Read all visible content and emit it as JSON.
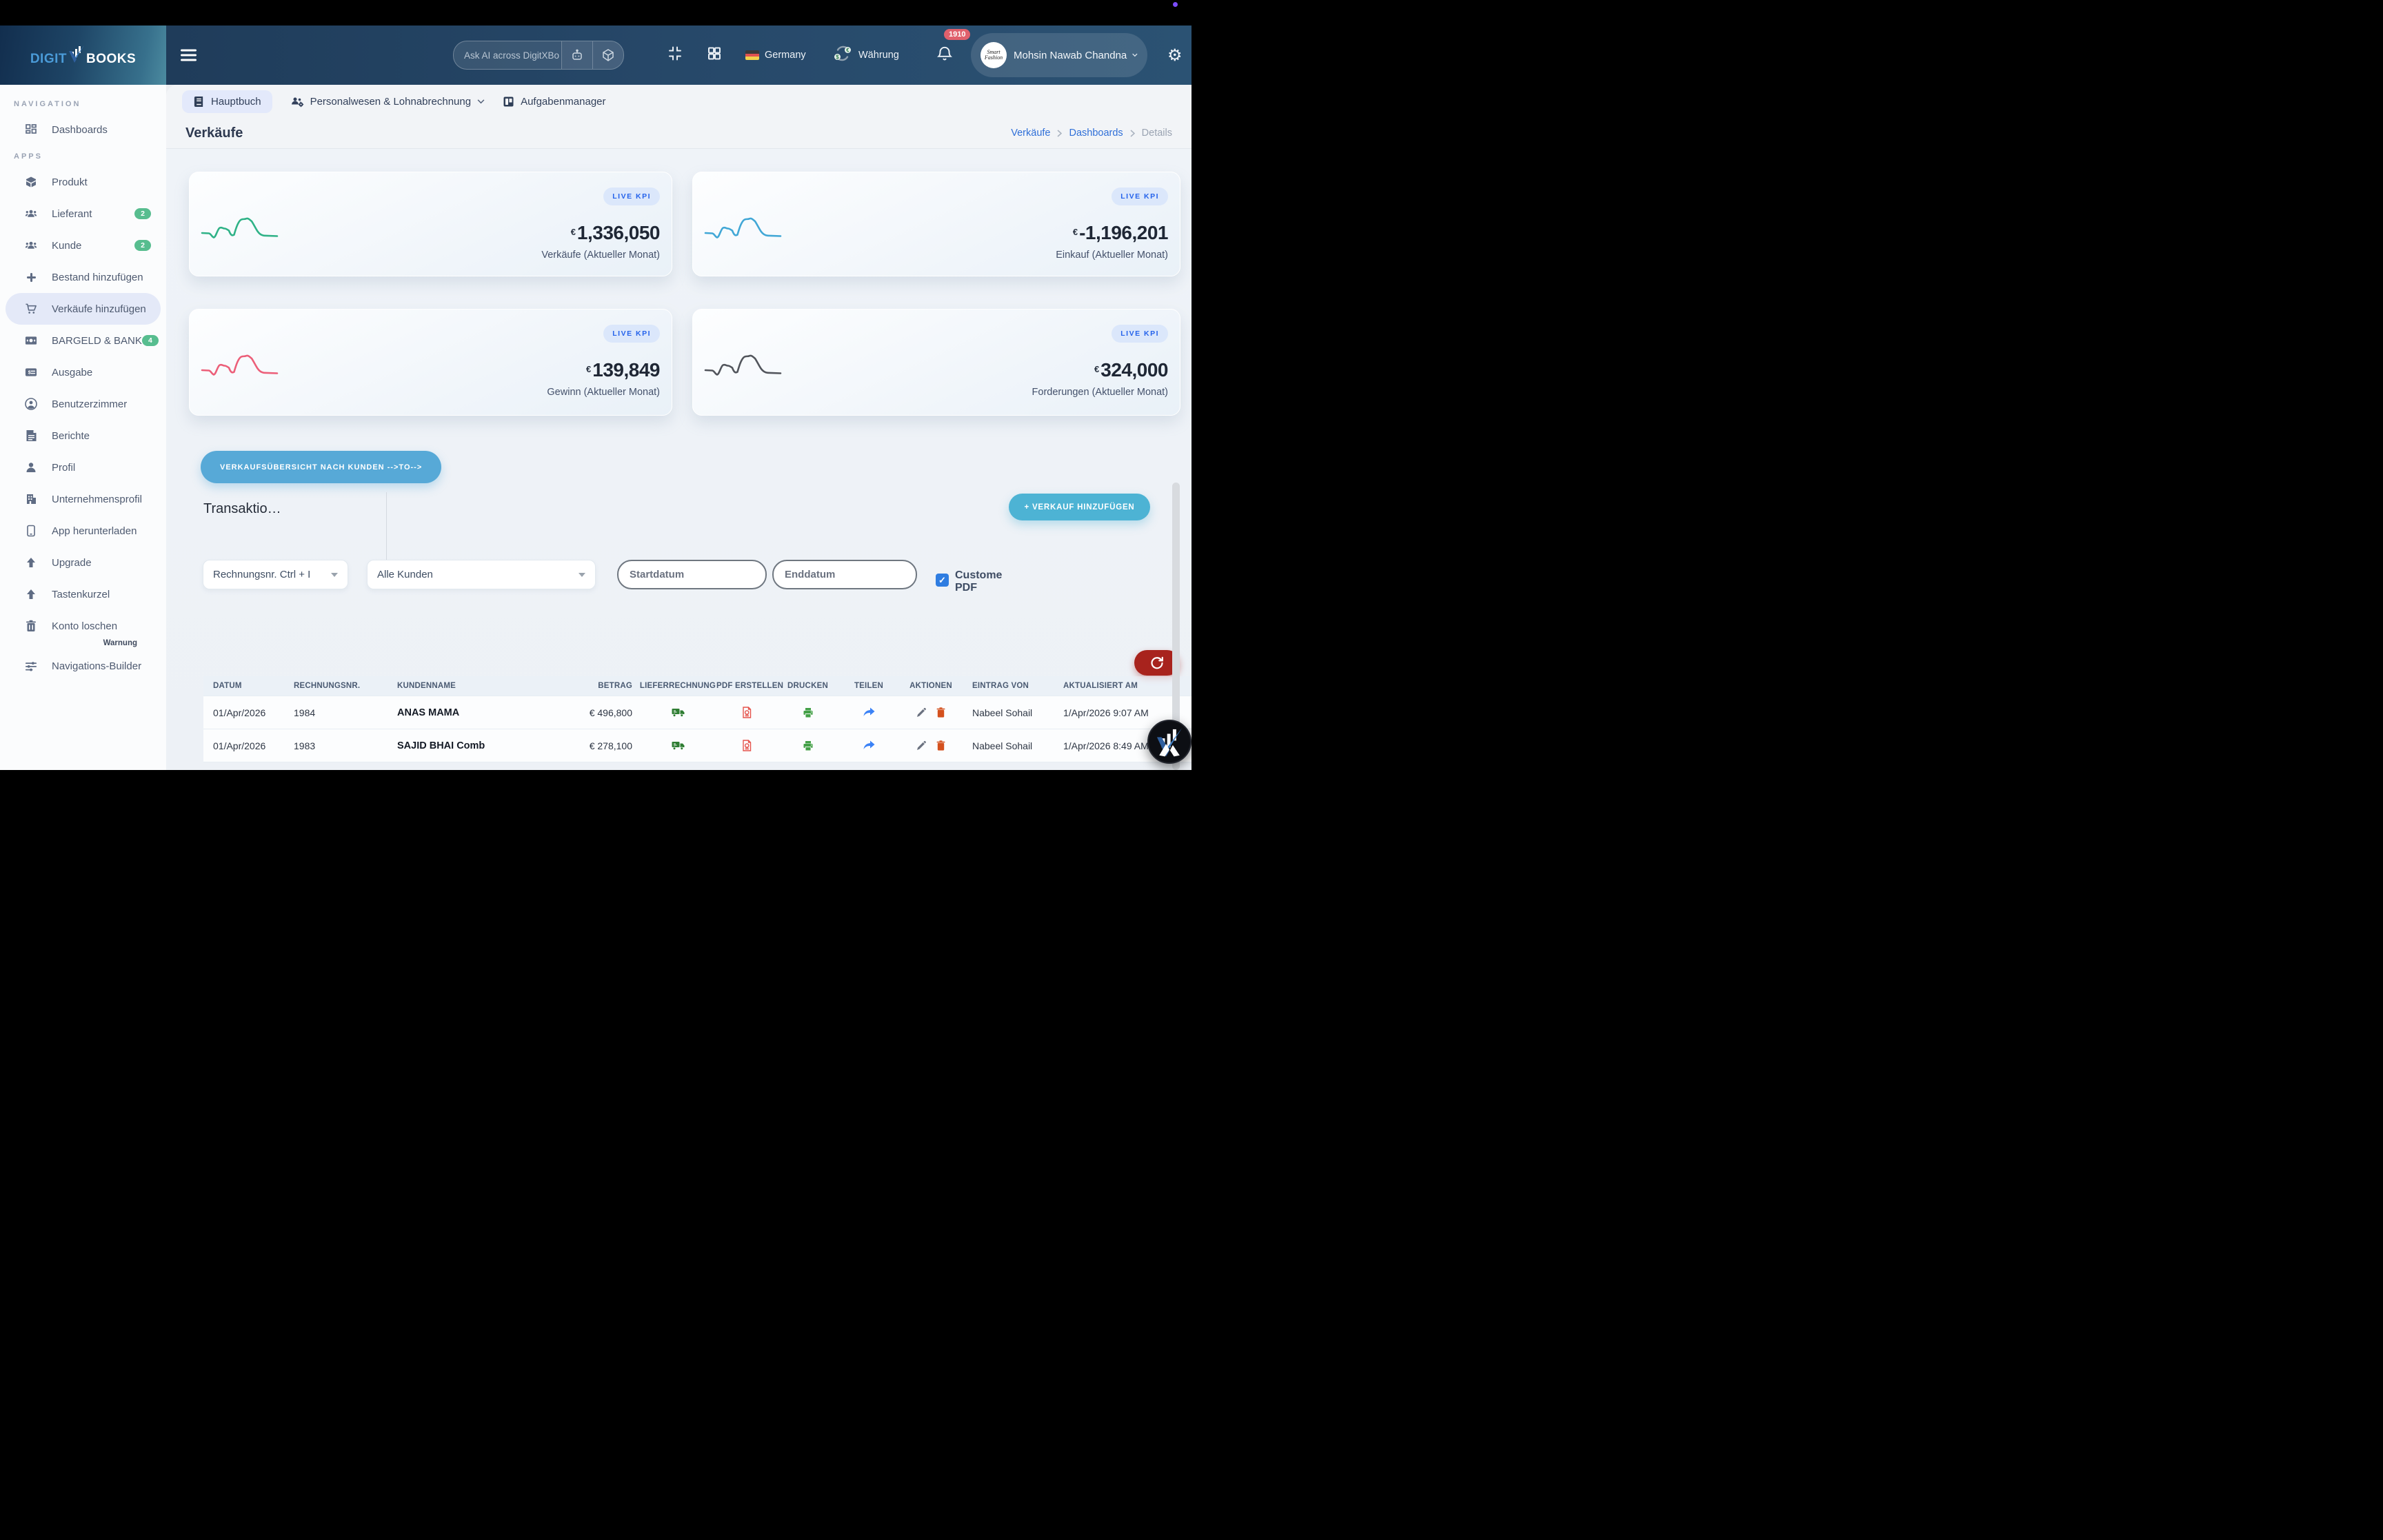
{
  "chrome": {
    "brand_left": "DIGIT",
    "brand_right": "BOOKS",
    "search_placeholder": "Ask AI across DigitXBo",
    "country": "Germany",
    "currency_label": "Währung",
    "notification_count": "1910",
    "user_name": "Mohsin Nawab Chandna",
    "avatar_text": "Smart Fashion"
  },
  "tabs": [
    {
      "label": "Hauptbuch"
    },
    {
      "label": "Personalwesen & Lohnabrechnung"
    },
    {
      "label": "Aufgabenmanager"
    }
  ],
  "page": {
    "title": "Verkäufe",
    "breadcrumb": [
      "Verkäufe",
      "Dashboards",
      "Details"
    ]
  },
  "sidebar": {
    "section_navigation": "NAVIGATION",
    "section_apps": "APPS",
    "warning": "Warnung",
    "items": [
      {
        "label": "Dashboards"
      },
      {
        "label": "Produkt"
      },
      {
        "label": "Lieferant",
        "badge": "2"
      },
      {
        "label": "Kunde",
        "badge": "2"
      },
      {
        "label": "Bestand hinzufügen"
      },
      {
        "label": "Verkäufe hinzufügen",
        "active": true
      },
      {
        "label": "BARGELD & BANK",
        "badge": "4"
      },
      {
        "label": "Ausgabe"
      },
      {
        "label": "Benutzerzimmer"
      },
      {
        "label": "Berichte"
      },
      {
        "label": "Profil"
      },
      {
        "label": "Unternehmensprofil"
      },
      {
        "label": "App herunterladen"
      },
      {
        "label": "Upgrade"
      },
      {
        "label": "Tastenkurzel"
      },
      {
        "label": "Konto loschen"
      },
      {
        "label": "Navigations-Builder"
      }
    ]
  },
  "kpis": [
    {
      "badge": "LIVE KPI",
      "currency": "€",
      "value": "1,336,050",
      "label": "Verkäufe (Aktueller Monat)",
      "color": "#2fb287"
    },
    {
      "badge": "LIVE KPI",
      "currency": "€",
      "value": "-1,196,201",
      "label": "Einkauf (Aktueller Monat)",
      "color": "#41a7d6"
    },
    {
      "badge": "LIVE KPI",
      "currency": "€",
      "value": "139,849",
      "label": "Gewinn (Aktueller Monat)",
      "color": "#ec5f79"
    },
    {
      "badge": "LIVE KPI",
      "currency": "€",
      "value": "324,000",
      "label": "Forderungen (Aktueller Monat)",
      "color": "#52555c"
    }
  ],
  "actions": {
    "overview_button": "VERKAUFSÜBERSICHT NACH KUNDEN -->TO-->",
    "transactions_title": "Transaktio…",
    "add_sale_button": "+ VERKAUF HINZUFÜGEN"
  },
  "filters": {
    "invoice_select": "Rechnungsnr. Ctrl + I",
    "customer_select": "Alle Kunden",
    "start_placeholder": "Startdatum",
    "end_placeholder": "Enddatum",
    "custom_pdf_label": "Custome PDF",
    "custom_pdf_checked": true
  },
  "table": {
    "columns": [
      "DATUM",
      "RECHNUNGSNR.",
      "KUNDENNAME",
      "BETRAG",
      "LIEFERRECHNUNG",
      "PDF ERSTELLEN",
      "DRUCKEN",
      "TEILEN",
      "AKTIONEN",
      "EINTRAG VON",
      "AKTUALISIERT AM"
    ],
    "rows": [
      {
        "datum": "01/Apr/2026",
        "rechnungsnr": "1984",
        "kundenname": "ANAS MAMA",
        "betrag": "€ 496,800",
        "eintrag_von": "Nabeel Sohail",
        "aktualisiert_am": "1/Apr/2026 9:07 AM"
      },
      {
        "datum": "01/Apr/2026",
        "rechnungsnr": "1983",
        "kundenname": "SAJID BHAI Comb",
        "betrag": "€ 278,100",
        "eintrag_von": "Nabeel Sohail",
        "aktualisiert_am": "1/Apr/2026 8:49 AM"
      }
    ]
  },
  "colors": {
    "header_navy": "#27496a",
    "primary_blue_button": "#57a9d7",
    "teal_button": "#4db3d4",
    "live_badge_text": "#2563eb",
    "refresh_red": "#a8231d",
    "sidebar_badge_green": "#57bd8f",
    "notification_red": "#e0606c"
  }
}
